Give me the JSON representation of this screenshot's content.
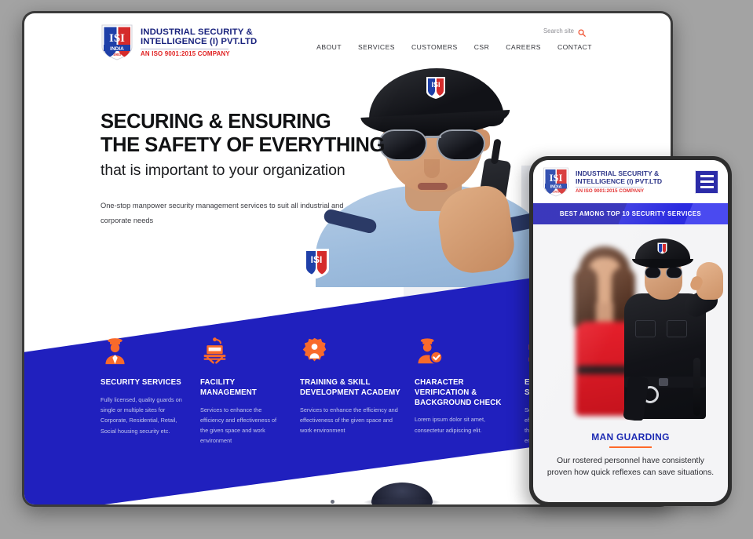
{
  "brand": {
    "mark_text": "ISI",
    "mark_sub": "INDIA",
    "mark_year": "1983",
    "name_line1": "INDUSTRIAL SECURITY &",
    "name_line2": "INTELLIGENCE (I) PVT.LTD",
    "iso": "AN ISO 9001:2015 COMPANY",
    "blue": "#1a237e",
    "red": "#e02020",
    "accent_blue": "#2020be",
    "accent_orange": "#ff6a2a"
  },
  "search": {
    "label": "Search site",
    "icon": "search-icon"
  },
  "nav": [
    {
      "label": "ABOUT"
    },
    {
      "label": "SERVICES"
    },
    {
      "label": "CUSTOMERS"
    },
    {
      "label": "CSR"
    },
    {
      "label": "CAREERS"
    },
    {
      "label": "CONTACT"
    }
  ],
  "hero": {
    "headline_line1": "SECURING & ENSURING",
    "headline_line2": "THE SAFETY OF EVERYTHING",
    "subhead": "that is important to your organization",
    "body": "One-stop manpower security management services to suit all industrial and corporate needs"
  },
  "cards": [
    {
      "icon": "police-officer-icon",
      "title": "SECURITY SERVICES",
      "body": "Fully licensed, quality guards on single or multiple sites for Corporate, Residential, Retail, Social housing security etc."
    },
    {
      "icon": "facility-building-icon",
      "title": "FACILITY MANAGEMENT",
      "body": "Services to enhance the efficiency and effectiveness of the given space and work environment"
    },
    {
      "icon": "training-gear-person-icon",
      "title": "TRAINING & SKILL DEVELOPMENT ACADEMY",
      "body": "Services to enhance the efficiency and effectiveness of the given space and work environment"
    },
    {
      "icon": "verified-officer-icon",
      "title": "CHARACTER VERIFICATION & BACKGROUND CHECK",
      "body": "Lorem ipsum dolor sit amet, consectetur adipiscing elit."
    },
    {
      "icon": "electronic-sensor-icon",
      "title": "ELECTRONIC SECURITY",
      "body": "Services to enhance the efficiency and effectiveness of the given space and work environment"
    }
  ],
  "phone": {
    "menu_icon": "hamburger-menu-icon",
    "banner": "BEST AMONG TOP 10 SECURITY SERVICES",
    "caption_title": "MAN GUARDING",
    "caption_body": "Our rostered personnel have consistently proven how quick reflexes can save situations."
  }
}
